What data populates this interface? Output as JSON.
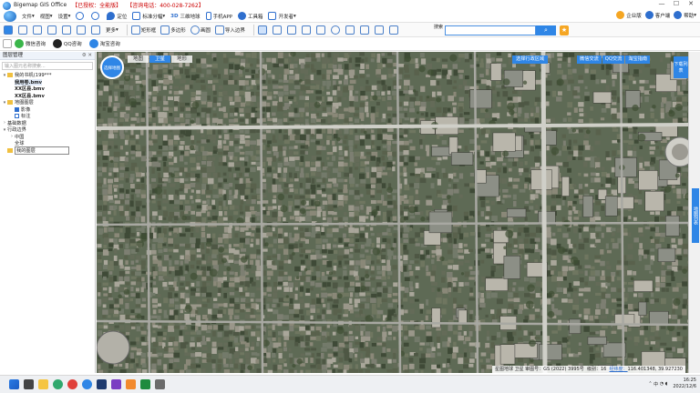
{
  "window": {
    "app_name": "Bigemap GIS Office",
    "edition": "【已授权：全能版】",
    "phone": "【咨询电话：400-028-7262】",
    "controls": [
      "—",
      "☐",
      "✕"
    ]
  },
  "menubar": {
    "items": [
      "文件",
      "视图",
      "设置",
      "定位",
      "标准分幅",
      "三维地球",
      "手机APP",
      "工具箱",
      "开发者"
    ],
    "right": [
      "企业版",
      "客户端",
      "帮助"
    ]
  },
  "toolbar": {
    "items": [
      "更多",
      "矩形框",
      "多边形",
      "画圆",
      "导入边界"
    ],
    "search_placeholder": "",
    "search_icon": "search-icon",
    "side_label": "搜索"
  },
  "tabbar": {
    "items": [
      "微信咨询",
      "QQ咨询",
      "淘宝咨询"
    ]
  },
  "panel": {
    "title": "图层管理",
    "filter_placeholder": "输入图元名称搜索...",
    "tree": [
      {
        "label": "我的书机(199***",
        "level": 0,
        "arrow": "▾",
        "kind": "folder"
      },
      {
        "label": "我用卷.bmv",
        "level": 1,
        "arrow": "",
        "kind": "file",
        "selected": true
      },
      {
        "label": "XX区县.bmv",
        "level": 1,
        "arrow": "",
        "kind": "file"
      },
      {
        "label": "XX区县.bmv",
        "level": 1,
        "arrow": "",
        "kind": "file"
      },
      {
        "label": "地图图层",
        "level": 0,
        "arrow": "▾",
        "kind": "folder"
      },
      {
        "label": "影像",
        "level": 1,
        "arrow": "",
        "kind": "check",
        "checked": true
      },
      {
        "label": "标注",
        "level": 1,
        "arrow": "",
        "kind": "check",
        "checked": false
      },
      {
        "label": "基础数据",
        "level": 0,
        "arrow": "›",
        "kind": "plain"
      },
      {
        "label": "行政边界",
        "level": 0,
        "arrow": "▾",
        "kind": "plain"
      },
      {
        "label": "中国",
        "level": 1,
        "arrow": "›",
        "kind": "plain"
      },
      {
        "label": "全球",
        "level": 1,
        "arrow": "",
        "kind": "plain"
      },
      {
        "label": "我的图层",
        "level": 0,
        "arrow": "",
        "kind": "box"
      }
    ]
  },
  "map": {
    "type_tabs": [
      {
        "label": "地图",
        "active": false
      },
      {
        "label": "卫星",
        "active": true
      },
      {
        "label": "地形",
        "active": false
      }
    ],
    "nav_label": "选择地图",
    "area_button": "选择行政区域",
    "consult_tabs": [
      "微信交流",
      "QQ交流",
      "淘宝指南"
    ],
    "download_task": "下载列表",
    "right_tab": "地图列表"
  },
  "status": {
    "source": "星图地球 卫星  审图号：GS (2022) 3995号",
    "level_label": "级别：",
    "level": "16",
    "coords_label": "经纬度：",
    "coords": "116.401348, 39.927230"
  },
  "taskbar": {
    "time": "16:25",
    "date": "2022/12/6",
    "lang": "中"
  },
  "colors": {
    "accent": "#2f86e6",
    "map_base": "#5e6a55"
  }
}
